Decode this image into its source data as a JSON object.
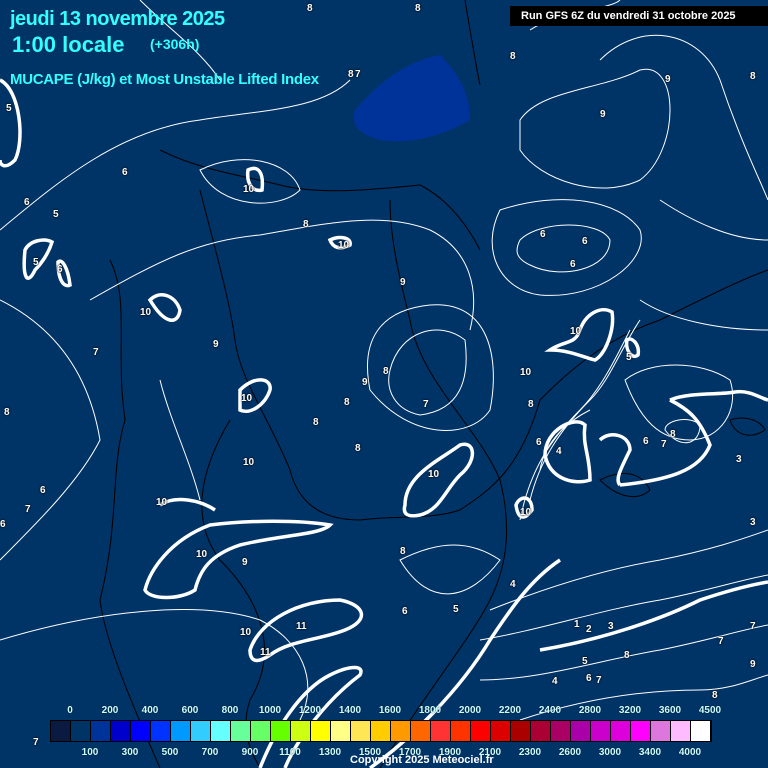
{
  "header": {
    "date": "jeudi 13 novembre 2025",
    "time": "1:00 locale",
    "lead": "(+306h)",
    "parameter": "MUCAPE (J/kg) et Most Unstable Lifted Index",
    "run": "Run GFS 6Z du vendredi 31 octobre 2025"
  },
  "contour_labels": [
    "8",
    "8",
    "8",
    "8",
    "9",
    "8",
    "9",
    "6",
    "7",
    "5",
    "6",
    "5",
    "5",
    "6",
    "10",
    "8",
    "10",
    "6",
    "6",
    "6",
    "9",
    "10",
    "9",
    "7",
    "10",
    "5",
    "10",
    "9",
    "8",
    "8",
    "8",
    "10",
    "8",
    "7",
    "8",
    "10",
    "8",
    "6",
    "4",
    "6",
    "7",
    "8",
    "3",
    "10",
    "10",
    "9",
    "10",
    "6",
    "7",
    "6",
    "10",
    "11",
    "11",
    "10",
    "8",
    "6",
    "5",
    "4",
    "1",
    "2",
    "3",
    "5",
    "6",
    "7",
    "8",
    "7",
    "9",
    "4",
    "8",
    "7",
    "3",
    "7"
  ],
  "legend": {
    "top_labels": [
      "0",
      "200",
      "400",
      "600",
      "800",
      "1000",
      "1200",
      "1400",
      "1600",
      "1800",
      "2000",
      "2200",
      "2400",
      "2800",
      "3200",
      "3600",
      "4500"
    ],
    "bottom_labels": [
      "100",
      "300",
      "500",
      "700",
      "900",
      "1100",
      "1300",
      "1500",
      "1700",
      "1900",
      "2100",
      "2300",
      "2600",
      "3000",
      "3400",
      "4000"
    ],
    "colors": [
      "#0a1a40",
      "#003366",
      "#003399",
      "#0000cc",
      "#0000ff",
      "#0033ff",
      "#0099ff",
      "#33ccff",
      "#66ffff",
      "#66ff99",
      "#66ff66",
      "#66ff00",
      "#ccff11",
      "#ffff00",
      "#ffff88",
      "#ffe655",
      "#ffcc00",
      "#ff9900",
      "#ff6600",
      "#ff3333",
      "#ff3300",
      "#ff0000",
      "#dd0000",
      "#aa0000",
      "#aa0033",
      "#aa0066",
      "#aa00aa",
      "#cc00cc",
      "#dd00dd",
      "#ff00ff",
      "#dd77dd",
      "#ffbbff",
      "#ffffff"
    ]
  },
  "copyright": "Copyright 2025 Meteociel.fr"
}
